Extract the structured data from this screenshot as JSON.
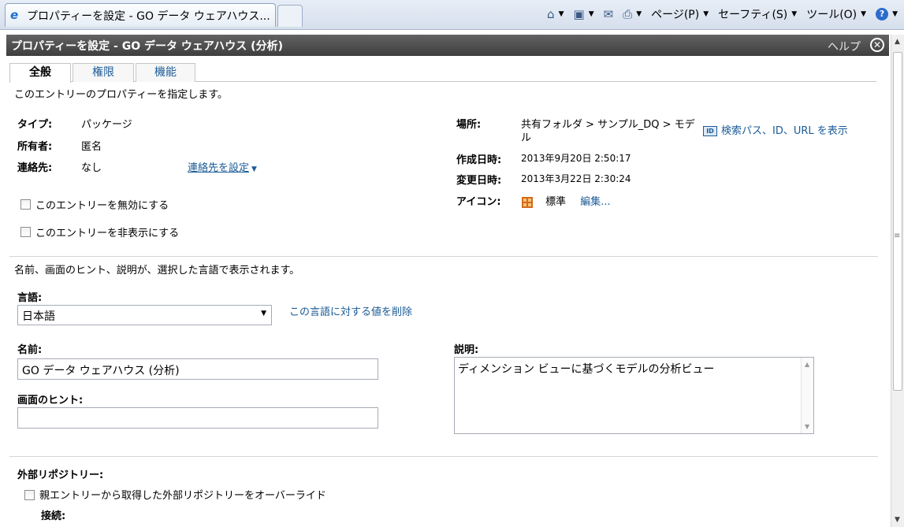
{
  "browser": {
    "tab_title": "プロパティーを設定 - GO データ ウェアハウス...",
    "menu": {
      "page": "ページ(P)",
      "safety": "セーフティ(S)",
      "tools": "ツール(O)"
    }
  },
  "dialog": {
    "title": "プロパティーを設定 - GO データ ウェアハウス (分析)",
    "help": "ヘルプ",
    "tabs": [
      "全般",
      "権限",
      "機能"
    ],
    "intro": "このエントリーのプロパティーを指定します。",
    "props": {
      "type_label": "タイプ:",
      "type_value": "パッケージ",
      "owner_label": "所有者:",
      "owner_value": "匿名",
      "contact_label": "連絡先:",
      "contact_value": "なし",
      "set_contact_link": "連絡先を設定",
      "location_label": "場所:",
      "location_value_line1": "共有フォルダ > サンプル_DQ > モデ",
      "location_value_line2": "ル",
      "show_path_link": "検索パス、ID、URL を表示",
      "created_label": "作成日時:",
      "created_value": "2013年9月20日 2:50:17",
      "modified_label": "変更日時:",
      "modified_value": "2013年3月22日 2:30:24",
      "icon_label": "アイコン:",
      "icon_value": "標準",
      "icon_edit_link": "編集..."
    },
    "checkboxes": {
      "disable": "このエントリーを無効にする",
      "hide": "このエントリーを非表示にする"
    },
    "lang_note": "名前、画面のヒント、説明が、選択した言語で表示されます。",
    "language_label": "言語:",
    "language_value": "日本語",
    "remove_lang_link": "この言語に対する値を削除",
    "name_label": "名前:",
    "name_value": "GO データ ウェアハウス (分析)",
    "screentip_label": "画面のヒント:",
    "screentip_value": "",
    "description_label": "説明:",
    "description_value": "ディメンション ビューに基づくモデルの分析ビュー",
    "external_repo_label": "外部リポジトリー:",
    "override_repo": "親エントリーから取得した外部リポジトリーをオーバーライド",
    "connection_label": "接続:"
  }
}
